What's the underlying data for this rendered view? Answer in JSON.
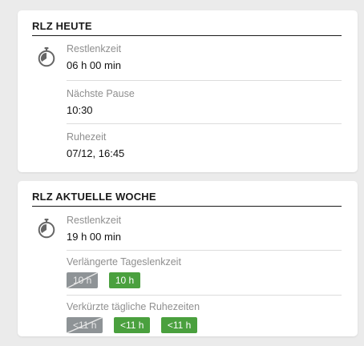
{
  "today": {
    "title": "RLZ HEUTE",
    "icon": "stopwatch-icon",
    "remaining_label": "Restlenkzeit",
    "remaining_value": "06 h 00 min",
    "next_break_label": "Nächste Pause",
    "next_break_value": "10:30",
    "rest_label": "Ruhezeit",
    "rest_value": "07/12, 16:45"
  },
  "week": {
    "title": "RLZ AKTUELLE WOCHE",
    "icon": "stopwatch-icon",
    "remaining_label": "Restlenkzeit",
    "remaining_value": "19 h 00 min",
    "extended_label": "Verlängerte Tageslenkzeit",
    "extended_chips": [
      "10 h",
      "10 h"
    ],
    "reduced_label": "Verkürzte tägliche Ruhezeiten",
    "reduced_chips": [
      "<11 h",
      "<11 h",
      "<11 h"
    ]
  },
  "colors": {
    "used_chip": "#8e9396",
    "available_chip": "#4aa03e"
  }
}
